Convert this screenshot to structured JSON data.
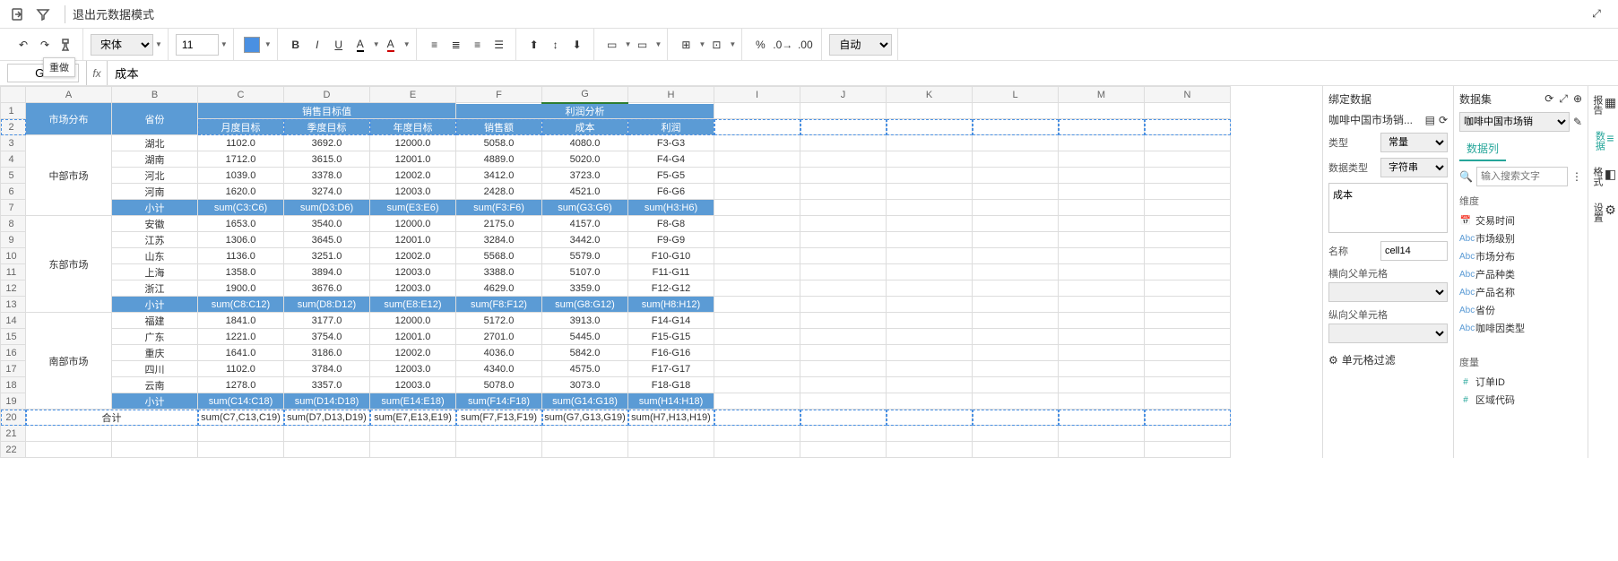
{
  "topbar": {
    "exit_label": "退出元数据模式",
    "redo_tooltip": "重做"
  },
  "formula_bar": {
    "cell_ref": "G2",
    "formula": "成本"
  },
  "format_bar": {
    "font": "宋体",
    "size": "11",
    "auto": "自动"
  },
  "columns": [
    "A",
    "B",
    "C",
    "D",
    "E",
    "F",
    "G",
    "H",
    "I",
    "J",
    "K",
    "L",
    "M",
    "N"
  ],
  "headers": {
    "market": "市场分布",
    "province": "省份",
    "sales_target": "销售目标值",
    "profit_analysis": "利润分析",
    "month": "月度目标",
    "quarter": "季度目标",
    "year": "年度目标",
    "sales": "销售额",
    "cost": "成本",
    "profit": "利润"
  },
  "markets": [
    "中部市场",
    "东部市场",
    "南部市场"
  ],
  "rows": [
    {
      "p": "湖北",
      "m": "1102.0",
      "q": "3692.0",
      "y": "12000.0",
      "s": "5058.0",
      "c": "4080.0",
      "pr": "F3-G3"
    },
    {
      "p": "湖南",
      "m": "1712.0",
      "q": "3615.0",
      "y": "12001.0",
      "s": "4889.0",
      "c": "5020.0",
      "pr": "F4-G4"
    },
    {
      "p": "河北",
      "m": "1039.0",
      "q": "3378.0",
      "y": "12002.0",
      "s": "3412.0",
      "c": "3723.0",
      "pr": "F5-G5"
    },
    {
      "p": "河南",
      "m": "1620.0",
      "q": "3274.0",
      "y": "12003.0",
      "s": "2428.0",
      "c": "4521.0",
      "pr": "F6-G6"
    },
    {
      "p": "小计",
      "m": "sum(C3:C6)",
      "q": "sum(D3:D6)",
      "y": "sum(E3:E6)",
      "s": "sum(F3:F6)",
      "c": "sum(G3:G6)",
      "pr": "sum(H3:H6)",
      "sub": true
    },
    {
      "p": "安徽",
      "m": "1653.0",
      "q": "3540.0",
      "y": "12000.0",
      "s": "2175.0",
      "c": "4157.0",
      "pr": "F8-G8"
    },
    {
      "p": "江苏",
      "m": "1306.0",
      "q": "3645.0",
      "y": "12001.0",
      "s": "3284.0",
      "c": "3442.0",
      "pr": "F9-G9"
    },
    {
      "p": "山东",
      "m": "1136.0",
      "q": "3251.0",
      "y": "12002.0",
      "s": "5568.0",
      "c": "5579.0",
      "pr": "F10-G10"
    },
    {
      "p": "上海",
      "m": "1358.0",
      "q": "3894.0",
      "y": "12003.0",
      "s": "3388.0",
      "c": "5107.0",
      "pr": "F11-G11"
    },
    {
      "p": "浙江",
      "m": "1900.0",
      "q": "3676.0",
      "y": "12003.0",
      "s": "4629.0",
      "c": "3359.0",
      "pr": "F12-G12"
    },
    {
      "p": "小计",
      "m": "sum(C8:C12)",
      "q": "sum(D8:D12)",
      "y": "sum(E8:E12)",
      "s": "sum(F8:F12)",
      "c": "sum(G8:G12)",
      "pr": "sum(H8:H12)",
      "sub": true
    },
    {
      "p": "福建",
      "m": "1841.0",
      "q": "3177.0",
      "y": "12000.0",
      "s": "5172.0",
      "c": "3913.0",
      "pr": "F14-G14"
    },
    {
      "p": "广东",
      "m": "1221.0",
      "q": "3754.0",
      "y": "12001.0",
      "s": "2701.0",
      "c": "5445.0",
      "pr": "F15-G15"
    },
    {
      "p": "重庆",
      "m": "1641.0",
      "q": "3186.0",
      "y": "12002.0",
      "s": "4036.0",
      "c": "5842.0",
      "pr": "F16-G16"
    },
    {
      "p": "四川",
      "m": "1102.0",
      "q": "3784.0",
      "y": "12003.0",
      "s": "4340.0",
      "c": "4575.0",
      "pr": "F17-G17"
    },
    {
      "p": "云南",
      "m": "1278.0",
      "q": "3357.0",
      "y": "12003.0",
      "s": "5078.0",
      "c": "3073.0",
      "pr": "F18-G18"
    },
    {
      "p": "小计",
      "m": "sum(C14:C18)",
      "q": "sum(D14:D18)",
      "y": "sum(E14:E18)",
      "s": "sum(F14:F18)",
      "c": "sum(G14:G18)",
      "pr": "sum(H14:H18)",
      "sub": true
    }
  ],
  "total_row": {
    "label": "合计",
    "m": "sum(C7,C13,C19)",
    "q": "sum(D7,D13,D19)",
    "y": "sum(E7,E13,E19)",
    "s": "sum(F7,F13,F19)",
    "c": "sum(G7,G13,G19)",
    "pr": "sum(H7,H13,H19)"
  },
  "bind_panel": {
    "title": "绑定数据",
    "dataset_label": "咖啡中国市场销...",
    "type_label": "类型",
    "type_value": "常量",
    "datatype_label": "数据类型",
    "datatype_value": "字符串",
    "const_value": "成本",
    "name_label": "名称",
    "name_value": "cell14",
    "h_parent_label": "横向父单元格",
    "v_parent_label": "纵向父单元格",
    "cell_filter": "单元格过滤"
  },
  "dataset_panel": {
    "title": "数据集",
    "selected": "咖啡中国市场销",
    "tab": "数据列",
    "search_placeholder": "输入搜索文字",
    "dim_title": "维度",
    "dims": [
      {
        "icon": "date",
        "label": "交易时间"
      },
      {
        "icon": "abc",
        "label": "市场级别"
      },
      {
        "icon": "abc",
        "label": "市场分布"
      },
      {
        "icon": "abc",
        "label": "产品种类"
      },
      {
        "icon": "abc",
        "label": "产品名称"
      },
      {
        "icon": "abc",
        "label": "省份"
      },
      {
        "icon": "abc",
        "label": "咖啡因类型"
      }
    ],
    "measure_title": "度量",
    "measures": [
      {
        "icon": "num",
        "label": "订单ID"
      },
      {
        "icon": "num",
        "label": "区域代码"
      }
    ]
  },
  "side_tabs": [
    "报告",
    "数据",
    "格式",
    "设置"
  ]
}
